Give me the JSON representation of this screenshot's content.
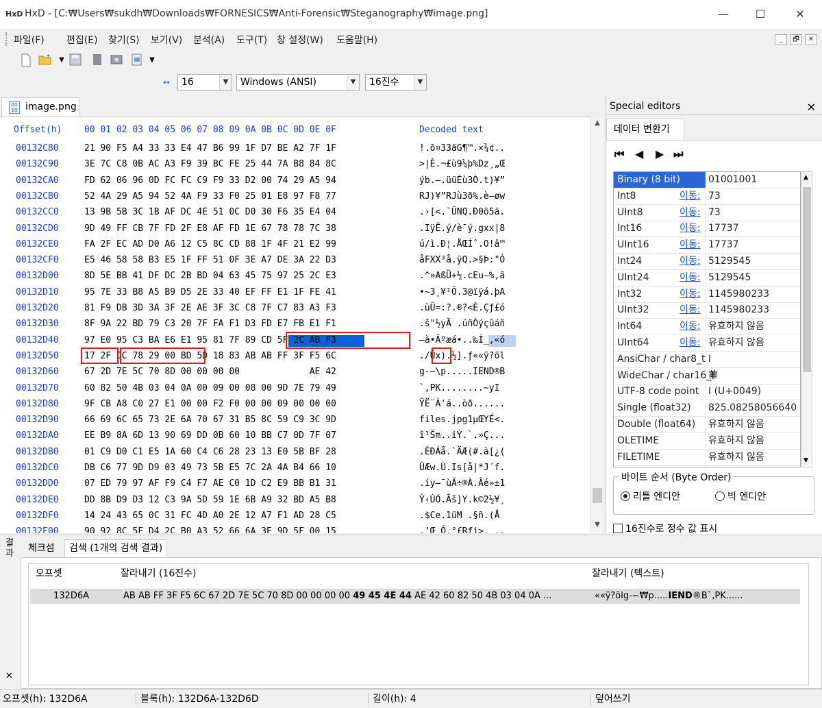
{
  "window": {
    "title": "HxD - [C:₩Users₩sukdh₩Downloads₩FORNESICS₩Anti-Forensic₩Steganography₩image.png]",
    "app_logo": "HxD",
    "minimize_label": "—",
    "maximize_label": "☐",
    "close_label": "✕"
  },
  "menu": {
    "items": [
      "파일(F)",
      "편집(E)",
      "찾기(S)",
      "보기(V)",
      "분석(A)",
      "도구(T)",
      "창 설정(W)",
      "도움말(H)"
    ],
    "mdi_minimize": "_",
    "mdi_restore": "🗗",
    "mdi_close": "✕"
  },
  "toolbar": {
    "icons": [
      "new-file-icon",
      "open-folder-icon",
      "save-icon",
      "properties-icon",
      "ram-icon",
      "disk-icon"
    ],
    "bytes_per_row": "16",
    "charset": "Windows (ANSI)",
    "offset_base": "16진수"
  },
  "document_tab": {
    "label": "image.png",
    "icon_text": "01\n10"
  },
  "hex": {
    "header_offset": "Offset(h)",
    "header_columns": "00 01 02 03 04 05 06 07 08 09 0A 0B 0C 0D 0E 0F",
    "header_decoded": "Decoded text",
    "rows": [
      {
        "offset": "00132C80",
        "hex": "21 90 F5 A4 33 33 E4 47 B6 99 1F D7 BE A2 7F 1F",
        "text": "!.õ¤33äG¶™.×¾¢.."
      },
      {
        "offset": "00132C90",
        "hex": "3E 7C C8 0B AC A3 F9 39 BC FE 25 44 7A B8 84 8C",
        "text": ">|È.¬£ù9¼þ%Dz¸„Œ"
      },
      {
        "offset": "00132CA0",
        "hex": "FD 62 06 96 0D FC FC C9 F9 33 D2 00 74 29 A5 94",
        "text": "ýb.–.üüÉù3Ò.t)¥”"
      },
      {
        "offset": "00132CB0",
        "hex": "52 4A 29 A5 94 52 4A F9 33 F0 25 01 E8 97 F8 77",
        "text": "RJ)¥”RJù3ð%.è—øw"
      },
      {
        "offset": "00132CC0",
        "hex": "13 9B 5B 3C 1B AF DC 4E 51 0C D0 30 F6 35 E4 04",
        "text": ".›[<.¯ÜNQ.Ð0ö5ä."
      },
      {
        "offset": "00132CD0",
        "hex": "9D 49 FF CB 7F FD 2F E8 AF FD 1E 67 78 78 7C 38",
        "text": ".IÿË.ý/è¯ý.gxx|8"
      },
      {
        "offset": "00132CE0",
        "hex": "FA 2F EC AD D0 A6 12 C5 8C CD 88 1F 4F 21 E2 99",
        "text": "ú/ì.Ð¦.ÅŒÍˆ.O!â™"
      },
      {
        "offset": "00132CF0",
        "hex": "E5 46 58 58 B3 E5 1F FF 51 0F 3E A7 DE 3A 22 D3",
        "text": "åFXX³å.ÿQ.>§Þ:\"Ó"
      },
      {
        "offset": "00132D00",
        "hex": "8D 5E BB 41 DF DC 2B BD 04 63 45 75 97 25 2C E3",
        "text": ".^»AßÜ+½.cEu—%,ã"
      },
      {
        "offset": "00132D10",
        "hex": "95 7E 33 B8 A5 B9 D5 2E 33 40 EF FF E1 1F FE 41",
        "text": "•~3¸¥¹Õ.3@ïÿá.þA"
      },
      {
        "offset": "00132D20",
        "hex": "81 F9 DB 3D 3A 3F 2E AE 3F 3C C8 7F C7 83 A3 F3",
        "text": ".ùÛ=:?.®?<È.Çƒ£ó"
      },
      {
        "offset": "00132D30",
        "hex": "8F 9A 22 BD 79 C3 20 7F FA F1 D3 FD E7 FB E1 F1",
        "text": ".š\"½yÃ .úñÓýçûáñ"
      },
      {
        "offset": "00132D40",
        "hex": "97 E0 95 C3 BA E6 E1 95 81 7F 89 CD 5F 2C AB F3",
        "text": "—à•Ãºæá•..‰Í_,«ó"
      },
      {
        "offset": "00132D50",
        "hex": "17 2F DC 78 29 00 BD 5D 18 83 AB AB FF 3F F5 6C",
        "text": "./Üx).½].ƒ««ÿ?õl"
      },
      {
        "offset": "00132D60",
        "hex": "67 2D 7E 5C 70 8D 00 00 00 00 49 45 4E 44 AE 42",
        "text": "g-~\\p.....IEND®B"
      },
      {
        "offset": "00132D70",
        "hex": "60 82 50 4B 03 04 0A 00 09 00 08 00 9D 7E 79 49",
        "text": "`‚PK........~yI"
      },
      {
        "offset": "00132D80",
        "hex": "9F CB A8 C0 27 E1 00 00 F2 F0 00 00 09 00 00 00",
        "text": "ŸË¨À'á..òð......"
      },
      {
        "offset": "00132D90",
        "hex": "66 69 6C 65 73 2E 6A 70 67 31 B5 8C 59 C9 3C 9D",
        "text": "files.jpg1µŒYÉ<."
      },
      {
        "offset": "00132DA0",
        "hex": "EE B9 8A 6D 13 90 69 DD 0B 60 10 BB C7 0D 7F 07",
        "text": "î¹Šm..iÝ.`.»Ç..."
      },
      {
        "offset": "00132DB0",
        "hex": "01 C9 D0 C1 E5 1A 60 C4 C6 28 23 13 E0 5B BF 28",
        "text": ".ÉÐÁå.`ÄÆ(#.à[¿("
      },
      {
        "offset": "00132DC0",
        "hex": "DB C6 77 9D D9 03 49 73 5B E5 7C 2A 4A B4 66 10",
        "text": "ÛÆw.Ù.Is[å|*J´f."
      },
      {
        "offset": "00132DD0",
        "hex": "07 ED 79 97 AF F9 C4 F7 AE C0 1D C2 E9 BB B1 31",
        "text": ".íy—¯ùÄ÷®À.Âé»±1"
      },
      {
        "offset": "00132DE0",
        "hex": "DD 8B D9 D3 12 C3 9A 5D 59 1E 6B A9 32 BD A5 B8",
        "text": "Ý‹ÙÓ.Ãš]Y.k©2½¥¸"
      },
      {
        "offset": "00132DF0",
        "hex": "14 24 43 65 0C 31 FC 4D A0 2E 12 A7 F1 AD 28 C5",
        "text": ".$Ce.1üM .§ñ.(Å"
      },
      {
        "offset": "00132E00",
        "hex": "90 92 8C 5F D4 2C B0 A3 52 66 6A 3E 9D 5F 00 15",
        "text": ".’Œ_Ô,°£Rfj>._.."
      },
      {
        "offset": "00132E10",
        "hex": "17 39 D2 01 66 B0 FC 04 AB F0 D7 3F E0 CA DE DA",
        "text": ".9Ò.f°ü.«ð×?àÊÞÚ"
      },
      {
        "offset": "00132E20",
        "hex": "9D C5 22 FB 2C 27 03 D1 7C C2 97 45 66 3D 7E 4D",
        "text": ".Å\"û,'.Ñ|Â—Ef=~M"
      },
      {
        "offset": "00132E30",
        "hex": "42 95 52 80 E2 C7 4C 96 57 D4 D0 83 B8 A9 1F D0",
        "text": "B•R€âÇL–WÔÐƒ¸©.Ð"
      },
      {
        "offset": "00132E40",
        "hex": "0C 25 81 40 32 11 F8 76 4A 3D 64 8B F5 D1 47 DB",
        "text": ".%.@2.øvJ=d‹õÑGÛ"
      }
    ]
  },
  "special_editors": {
    "title": "Special editors",
    "close": "✕",
    "tab": "데이터 변환기",
    "nav": [
      "⏮",
      "◀",
      "▶",
      "⏭"
    ],
    "move_label": "이동:",
    "rows": [
      {
        "label": "Binary (8 bit)",
        "value": "01001001",
        "move": false
      },
      {
        "label": "Int8",
        "value": "73",
        "move": true
      },
      {
        "label": "UInt8",
        "value": "73",
        "move": true
      },
      {
        "label": "Int16",
        "value": "17737",
        "move": true
      },
      {
        "label": "UInt16",
        "value": "17737",
        "move": true
      },
      {
        "label": "Int24",
        "value": "5129545",
        "move": true
      },
      {
        "label": "UInt24",
        "value": "5129545",
        "move": true
      },
      {
        "label": "Int32",
        "value": "1145980233",
        "move": true
      },
      {
        "label": "UInt32",
        "value": "1145980233",
        "move": true
      },
      {
        "label": "Int64",
        "value": "유효하지 않음",
        "move": true
      },
      {
        "label": "UInt64",
        "value": "유효하지 않음",
        "move": true
      },
      {
        "label": "AnsiChar / char8_t",
        "value": "I",
        "move": false
      },
      {
        "label": "WideChar / char16_t",
        "value": "䕉",
        "move": false
      },
      {
        "label": "UTF-8 code point",
        "value": "I (U+0049)",
        "move": false
      },
      {
        "label": "Single (float32)",
        "value": "825.08258056640",
        "move": false
      },
      {
        "label": "Double (float64)",
        "value": "유효하지 않음",
        "move": false
      },
      {
        "label": "OLETIME",
        "value": "유효하지 않음",
        "move": false
      },
      {
        "label": "FILETIME",
        "value": "유효하지 않음",
        "move": false
      }
    ],
    "byte_order_title": "바이트 순서 (Byte Order)",
    "little_endian": "리틀 엔디안",
    "big_endian": "빅 엔디안",
    "hex_int_checkbox": "16진수로 정수 값 표시"
  },
  "results": {
    "side_label": "결\n과",
    "side_close": "✕",
    "tabs": [
      "체크섬",
      "검색 (1개의 검색 결과)"
    ],
    "col_offset": "오프셋",
    "col_hex": "잘라내기 (16진수)",
    "col_text": "잘라내기 (텍스트)",
    "row": {
      "offset": "132D6A",
      "hex_before": "AB AB FF 3F F5 6C 67 2D 7E 5C 70 8D 00 00 00 00 ",
      "hex_bold": "49 45 4E 44",
      "hex_after": " AE 42 60 82 50 4B 03 04 0A ...",
      "text_before": "««ÿ?õlg-~₩p.....",
      "text_bold": "IEND",
      "text_after": "®B`‚PK......"
    }
  },
  "status": {
    "offset": "오프셋(h): 132D6A",
    "block": "블록(h): 132D6A-132D6D",
    "length": "길이(h): 4",
    "mode": "덮어쓰기"
  }
}
